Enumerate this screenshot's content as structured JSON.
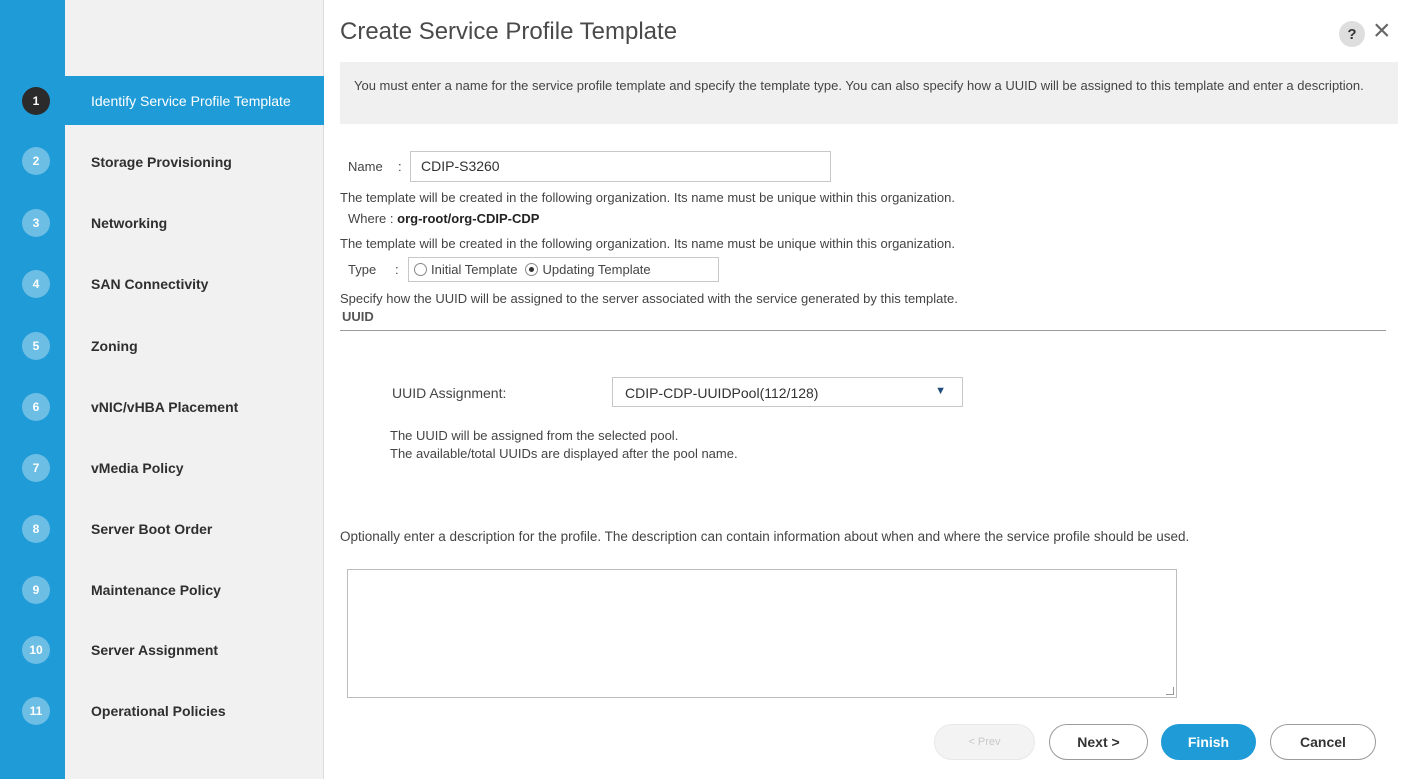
{
  "wizard": {
    "steps": [
      {
        "number": "1",
        "label": "Identify Service Profile Template",
        "active": true
      },
      {
        "number": "2",
        "label": "Storage Provisioning"
      },
      {
        "number": "3",
        "label": "Networking"
      },
      {
        "number": "4",
        "label": "SAN Connectivity"
      },
      {
        "number": "5",
        "label": "Zoning"
      },
      {
        "number": "6",
        "label": "vNIC/vHBA Placement"
      },
      {
        "number": "7",
        "label": "vMedia Policy"
      },
      {
        "number": "8",
        "label": "Server Boot Order"
      },
      {
        "number": "9",
        "label": "Maintenance Policy"
      },
      {
        "number": "10",
        "label": "Server Assignment"
      },
      {
        "number": "11",
        "label": "Operational Policies"
      }
    ]
  },
  "dialog": {
    "title": "Create Service Profile Template",
    "help_glyph": "?",
    "close_glyph": "×",
    "info": "You must enter a name for the service profile template and specify the template type. You can also specify how a UUID will be assigned to this template and enter a description."
  },
  "form": {
    "name_label": "Name",
    "name_sep": ":",
    "name_value": "CDIP-S3260",
    "org_note": "The template will be created in the following organization. Its name must be unique within this organization.",
    "where_label": "Where :",
    "where_value": "org-root/org-CDIP-CDP",
    "type_note": "The template will be created in the following organization. Its name must be unique within this organization.",
    "type_label": "Type",
    "type_sep": ":",
    "type_options": [
      {
        "label": "Initial Template",
        "checked": false
      },
      {
        "label": "Updating Template",
        "checked": true
      }
    ],
    "uuid_note": "Specify how the UUID will be assigned to the server associated with the service generated by this template.",
    "uuid_heading": "UUID",
    "uuid_assignment_label": "UUID Assignment:",
    "uuid_assignment_value": "CDIP-CDP-UUIDPool(112/128)",
    "uuid_help_line1": "The UUID will be assigned from the selected pool.",
    "uuid_help_line2": "The available/total UUIDs are displayed after the pool name.",
    "description_note": "Optionally enter a description for the profile. The description can contain information about when and where the service profile should be used.",
    "description_value": ""
  },
  "buttons": {
    "prev": "< Prev",
    "next": "Next >",
    "finish": "Finish",
    "cancel": "Cancel"
  },
  "colors": {
    "accent": "#1f9bd7",
    "active_badge": "#2b2b2b"
  }
}
